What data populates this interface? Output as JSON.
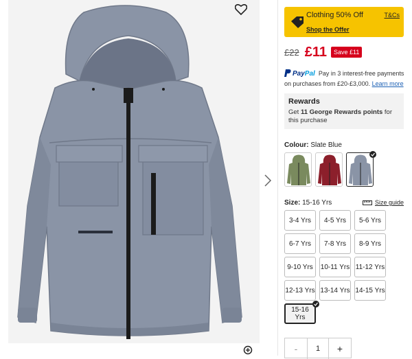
{
  "product": {
    "image_alt": "Slate Blue hooded jacket",
    "colors": {
      "jacket": "#8a94a6",
      "zip": "#1b1b1b",
      "promo": "#f6c300",
      "price": "#d6001c"
    }
  },
  "promo": {
    "title": "Clothing 50% Off",
    "link": "Shop the Offer",
    "tcs": "T&Cs",
    "icon": "tag-icon"
  },
  "price": {
    "was": "£22",
    "now": "£11",
    "save": "Save  £11"
  },
  "paypal": {
    "brand_a": "Pay",
    "brand_b": "Pal",
    "text": "Pay in 3 interest-free payments on purchases from £20-£3,000.",
    "link": "Learn more"
  },
  "rewards": {
    "title": "Rewards",
    "pre": "Get ",
    "bold": "11 George Rewards points",
    "post": " for this purchase"
  },
  "colour": {
    "label": "Colour:",
    "value": "Slate Blue",
    "swatches": [
      {
        "name": "Khaki",
        "hex": "#7a8a5e"
      },
      {
        "name": "Burgundy",
        "hex": "#8c1f2b"
      },
      {
        "name": "Slate Blue",
        "hex": "#8a94a6",
        "selected": true
      }
    ]
  },
  "size": {
    "label": "Size:",
    "value": "15-16 Yrs",
    "guide": "Size guide",
    "options": [
      "3-4 Yrs",
      "4-5 Yrs",
      "5-6 Yrs",
      "6-7 Yrs",
      "7-8 Yrs",
      "8-9 Yrs",
      "9-10 Yrs",
      "10-11 Yrs",
      "11-12 Yrs",
      "12-13 Yrs",
      "13-14 Yrs",
      "14-15 Yrs",
      "15-16 Yrs"
    ],
    "selected": "15-16 Yrs"
  },
  "quantity": {
    "minus": "-",
    "value": "1",
    "plus": "+"
  }
}
